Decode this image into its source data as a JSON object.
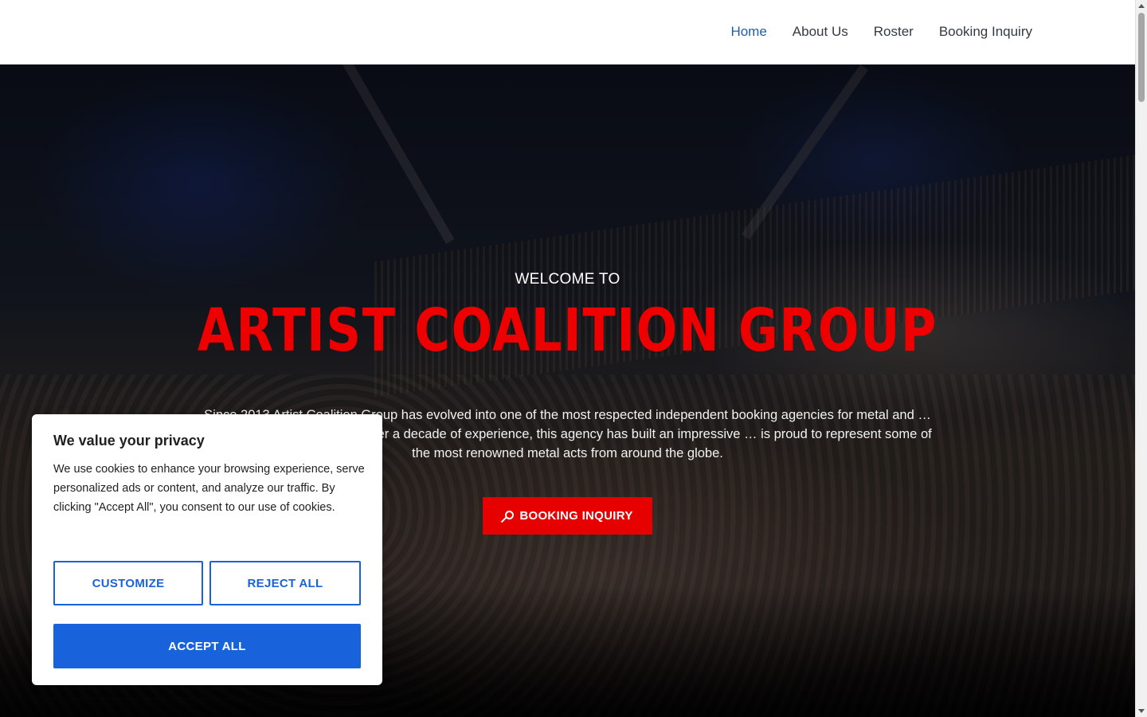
{
  "nav": {
    "items": [
      {
        "label": "Home",
        "active": true
      },
      {
        "label": "About Us",
        "active": false
      },
      {
        "label": "Roster",
        "active": false
      },
      {
        "label": "Booking Inquiry",
        "active": false
      }
    ]
  },
  "hero": {
    "welcome": "WELCOME TO",
    "title": "ARTIST COALITION GROUP",
    "intro": "Since 2013 Artist Coalition Group has evolved into one of the most respected independent booking agencies for metal and … by an industry veteran with over a decade of experience, this agency has built an impressive … is proud to represent some of the most renowned metal acts from around the globe.",
    "button_label": "BOOKING INQUIRY",
    "button_icon": "microphone-icon"
  },
  "cookie": {
    "title": "We value your privacy",
    "text": "We use cookies to enhance your browsing experience, serve personalized ads or content, and analyze our traffic. By clicking \"Accept All\", you consent to our use of cookies.",
    "customize_label": "CUSTOMIZE",
    "reject_label": "REJECT ALL",
    "accept_label": "ACCEPT ALL"
  },
  "colors": {
    "accent_red": "#e60000",
    "title_red": "#ee0000",
    "cookie_blue": "#1863dc",
    "nav_active": "#1c5fa8"
  }
}
